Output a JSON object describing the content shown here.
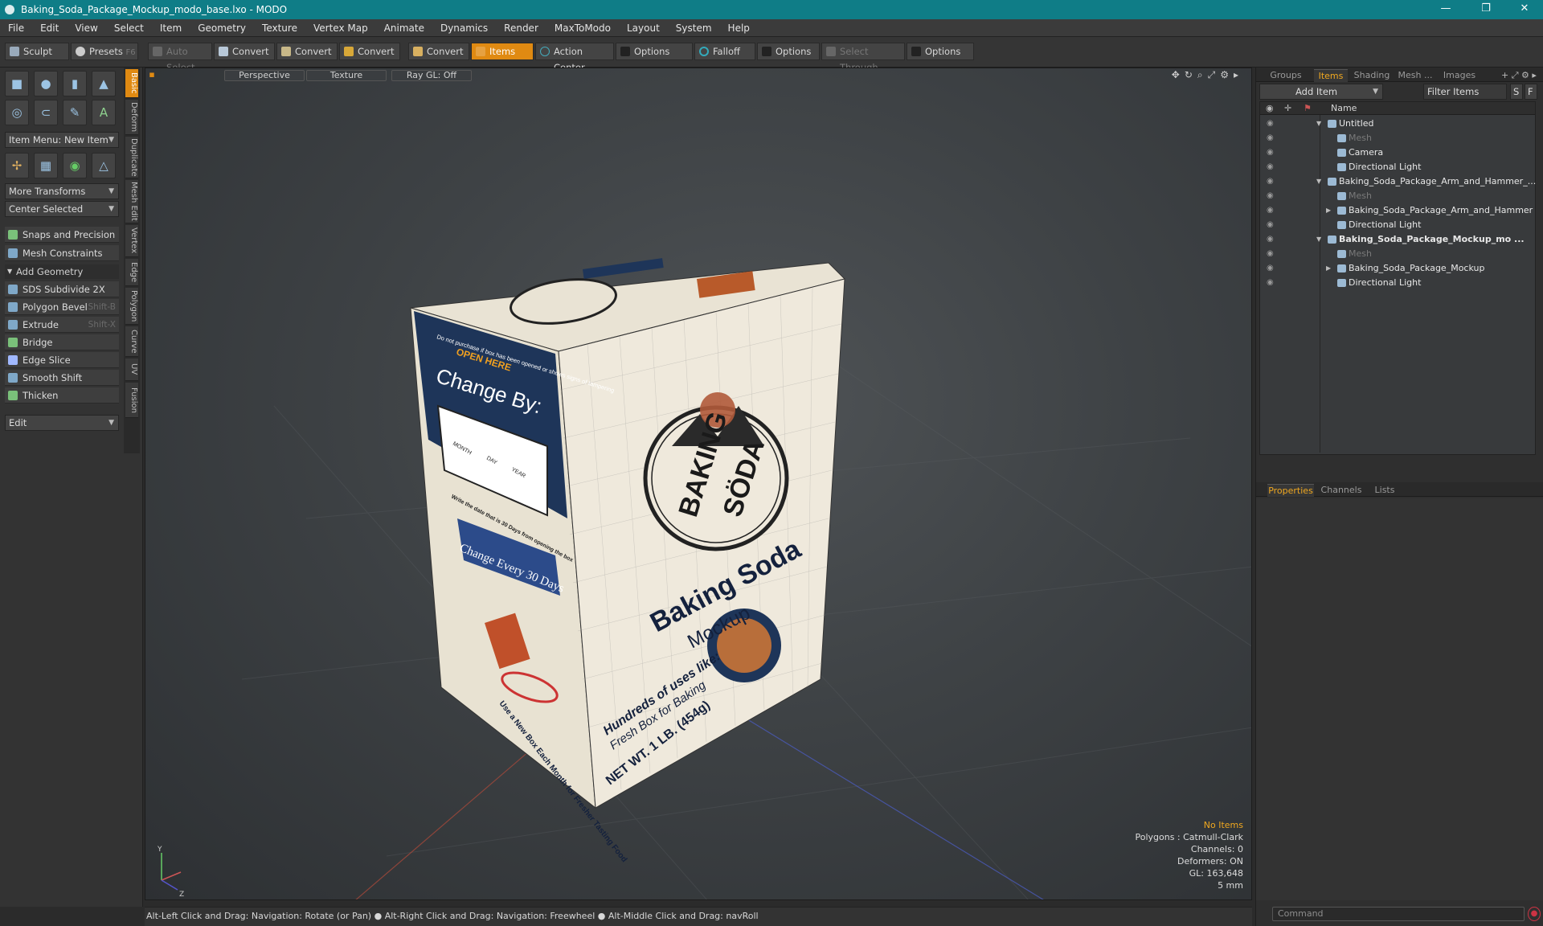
{
  "window": {
    "title": "Baking_Soda_Package_Mockup_modo_base.lxo - MODO",
    "minimize": "—",
    "maximize": "❐",
    "close": "✕"
  },
  "menu": [
    "File",
    "Edit",
    "View",
    "Select",
    "Item",
    "Geometry",
    "Texture",
    "Vertex Map",
    "Animate",
    "Dynamics",
    "Render",
    "MaxToModo",
    "Layout",
    "System",
    "Help"
  ],
  "toolbar": {
    "sculpt": "Sculpt",
    "presets": "Presets",
    "presets_shortcut": "F6",
    "auto_select": "Auto Select",
    "convert1": "Convert",
    "convert2": "Convert",
    "convert3": "Convert",
    "convert4": "Convert",
    "items": "Items",
    "action_center": "Action Center",
    "options1": "Options",
    "falloff": "Falloff",
    "options2": "Options",
    "select_through": "Select Through",
    "options3": "Options"
  },
  "left": {
    "item_menu": "Item Menu: New Item",
    "more_transforms": "More Transforms",
    "center_selected": "Center Selected",
    "snaps": "Snaps and Precision",
    "mesh_constraints": "Mesh Constraints",
    "add_geometry": "Add Geometry",
    "tools": [
      {
        "label": "SDS Subdivide 2X",
        "shortcut": ""
      },
      {
        "label": "Polygon Bevel",
        "shortcut": "Shift-B"
      },
      {
        "label": "Extrude",
        "shortcut": "Shift-X"
      },
      {
        "label": "Bridge",
        "shortcut": ""
      },
      {
        "label": "Edge Slice",
        "shortcut": ""
      },
      {
        "label": "Smooth Shift",
        "shortcut": ""
      },
      {
        "label": "Thicken",
        "shortcut": ""
      }
    ],
    "edit": "Edit",
    "vtabs": [
      "Basic",
      "Deform",
      "Duplicate",
      "Mesh Edit",
      "Vertex",
      "Edge",
      "Polygon",
      "Curve",
      "UV",
      "Fusion"
    ]
  },
  "viewport": {
    "perspective": "Perspective",
    "texture": "Texture",
    "raygl": "Ray GL: Off",
    "stats": {
      "no_items": "No Items",
      "polygons": "Polygons : Catmull-Clark",
      "channels": "Channels: 0",
      "deformers": "Deformers: ON",
      "gl": "GL: 163,648",
      "unit": "5 mm"
    },
    "axis_y": "Y",
    "axis_z": "Z"
  },
  "status": "Alt-Left Click and Drag: Navigation: Rotate (or Pan) ● Alt-Right Click and Drag: Navigation: Freewheel ● Alt-Middle Click and Drag: navRoll",
  "box": {
    "brand1": "BAKING",
    "brand2": "SÖDA",
    "name": "Baking Soda",
    "mockup": "Mockup",
    "hundreds": "Hundreds of uses like:",
    "fresh": "Fresh Box for Baking",
    "net": "NET WT. 1 LB. (454g)",
    "dont": "Do not purchase if box has been opened or shows signs of tampering",
    "open": "OPEN HERE",
    "change_by": "Change By:",
    "month": "MONTH",
    "day": "DAY",
    "year": "YEAR",
    "write": "Write the date that is 30 Days from opening the box",
    "change_every": "Change Every 30 Days",
    "use_new": "Use a New Box Each Month for Fresher Tasting Food"
  },
  "right": {
    "tabs": [
      "Groups",
      "Items",
      "Shading",
      "Mesh ...",
      "Images"
    ],
    "add_item": "Add Item",
    "filter_items": "Filter Items",
    "s_btn": "S",
    "f_btn": "F",
    "col_name": "Name",
    "items": [
      {
        "label": "Untitled",
        "indent": 0,
        "twisty": "▼",
        "style": "normal"
      },
      {
        "label": "Mesh",
        "indent": 1,
        "twisty": "",
        "style": "grey"
      },
      {
        "label": "Camera",
        "indent": 1,
        "twisty": "",
        "style": "normal"
      },
      {
        "label": "Directional Light",
        "indent": 1,
        "twisty": "",
        "style": "normal"
      },
      {
        "label": "Baking_Soda_Package_Arm_and_Hammer_...",
        "indent": 0,
        "twisty": "▼",
        "style": "normal"
      },
      {
        "label": "Mesh",
        "indent": 1,
        "twisty": "",
        "style": "grey"
      },
      {
        "label": "Baking_Soda_Package_Arm_and_Hammer",
        "indent": 1,
        "twisty": "▶",
        "style": "normal"
      },
      {
        "label": "Directional Light",
        "indent": 1,
        "twisty": "",
        "style": "normal"
      },
      {
        "label": "Baking_Soda_Package_Mockup_mo ...",
        "indent": 0,
        "twisty": "▼",
        "style": "bold"
      },
      {
        "label": "Mesh",
        "indent": 1,
        "twisty": "",
        "style": "grey"
      },
      {
        "label": "Baking_Soda_Package_Mockup",
        "indent": 1,
        "twisty": "▶",
        "style": "normal"
      },
      {
        "label": "Directional Light",
        "indent": 1,
        "twisty": "",
        "style": "normal"
      }
    ],
    "prop_tabs": [
      "Properties",
      "Channels",
      "Lists"
    ],
    "command_placeholder": "Command"
  }
}
